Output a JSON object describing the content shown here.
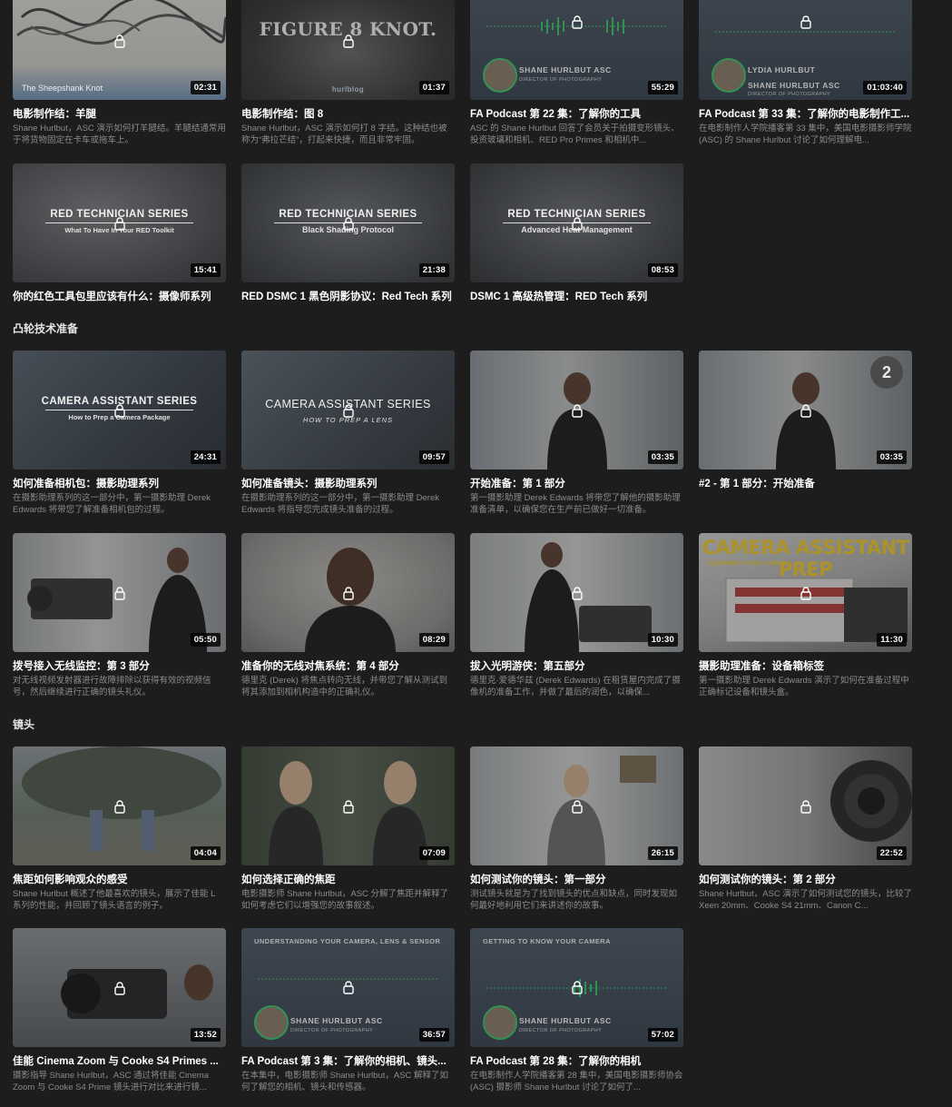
{
  "sections": [
    {
      "title": ""
    },
    {
      "title": "凸轮技术准备"
    },
    {
      "title": "镜头"
    }
  ],
  "rows": [
    [
      {
        "title": "电影制作结：羊腿",
        "desc": "Shane Hurlbut，ASC 演示如何打羊腿结。羊腿结通常用于将货物固定在卡车或拖车上。",
        "duration": "02:31",
        "overlay": "The Sheepshank Knot",
        "thumb_icon": "rope-knot"
      },
      {
        "title": "电影制作结：图 8",
        "desc": "Shane Hurlbut，ASC 演示如何打 8 字结。这种结也被称为“弗拉芒结”，打起来快捷，而且非常牢固。",
        "duration": "01:37",
        "overlay": "FIGURE 8 KNOT.",
        "brand": "hurlblog",
        "thumb_icon": "rope"
      },
      {
        "title": "FA Podcast 第 22 集：了解你的工具",
        "desc": "ASC 的 Shane Hurlbut 回答了会员关于拍摄变形镜头、投资玻璃和相机、RED Pro Primes 和相机中...",
        "duration": "55:29",
        "podcast_name": "SHANE HURLBUT ASC",
        "podcast_role": "DIRECTOR OF PHOTOGRAPHY"
      },
      {
        "title": "FA Podcast 第 33 集：了解你的电影制作工...",
        "desc": "在电影制作人学院播客第 33 集中，美国电影摄影师学院 (ASC) 的 Shane Hurlbut 讨论了如何理解电...",
        "duration": "01:03:40",
        "podcast_name": "LYDIA HURLBUT",
        "podcast_name2": "SHANE HURLBUT ASC",
        "podcast_role": "DIRECTOR OF PHOTOGRAPHY"
      }
    ],
    [
      {
        "title": "你的红色工具包里应该有什么：摄像师系列",
        "desc": "",
        "duration": "15:41",
        "overlay": "RED TECHNICIAN SERIES",
        "overlay_sub": "What To Have In Your RED Toolkit"
      },
      {
        "title": "RED DSMC 1 黑色阴影协议：Red Tech 系列",
        "desc": "",
        "duration": "21:38",
        "overlay": "RED TECHNICIAN SERIES",
        "overlay_sub": "Black Shading Protocol"
      },
      {
        "title": "DSMC 1 高级热管理：RED Tech 系列",
        "desc": "",
        "duration": "08:53",
        "overlay": "RED TECHNICIAN SERIES",
        "overlay_sub": "Advanced Heat Management"
      }
    ],
    [
      {
        "title": "如何准备相机包：摄影助理系列",
        "desc": "在摄影助理系列的这一部分中，第一摄影助理 Derek Edwards 将带您了解准备相机包的过程。",
        "duration": "24:31",
        "overlay": "CAMERA ASSISTANT SERIES",
        "overlay_sub": "How to Prep a Camera Package"
      },
      {
        "title": "如何准备镜头：摄影助理系列",
        "desc": "在摄影助理系列的这一部分中，第一摄影助理 Derek Edwards 将指导您完成镜头准备的过程。",
        "duration": "09:57",
        "overlay": "CAMERA ASSISTANT SERIES",
        "overlay_sub": "HOW TO PREP A LENS"
      },
      {
        "title": "开始准备：第 1 部分",
        "desc": "第一摄影助理 Derek Edwards 将带您了解他的摄影助理准备清单，以确保您在生产前已做好一切准备。",
        "duration": "03:35"
      },
      {
        "title": "#2 - 第 1 部分：开始准备",
        "desc": "",
        "duration": "03:35",
        "badge": "2"
      }
    ],
    [
      {
        "title": "拨号接入无线监控：第 3 部分",
        "desc": "对无线视频发射器进行故障排除以获得有效的视频信号，然后继续进行正确的镜头礼仪。",
        "duration": "05:50"
      },
      {
        "title": "准备你的无线对焦系统：第 4 部分",
        "desc": "德里克 (Derek) 将焦点转向无线，并带您了解从测试到将其添加到相机构造中的正确礼仪。",
        "duration": "08:29"
      },
      {
        "title": "拔入光明游侠：第五部分",
        "desc": "德里克·爱德华兹 (Derek Edwards) 在租赁屋内完成了摄像机的准备工作，并做了最后的润色，以确保...",
        "duration": "10:30"
      },
      {
        "title": "摄影助理准备：设备箱标签",
        "desc": "第一摄影助理 Derek Edwards 演示了如何在准备过程中正确标记设备和镜头盒。",
        "duration": "11:30",
        "overlay": "CAMERA ASSISTANT PREP",
        "overlay_sub": "EQUIPMENT CASE LABELS"
      }
    ],
    [
      {
        "title": "焦距如何影响观众的感受",
        "desc": "Shane Hurlbut 概述了他最喜欢的镜头，展示了佳能 L 系列的性能，并回顾了镜头语言的例子。",
        "duration": "04:04"
      },
      {
        "title": "如何选择正确的焦距",
        "desc": "电影摄影师 Shane Hurlbut，ASC 分解了焦距并解释了如何考虑它们以增强您的故事叙述。",
        "duration": "07:09"
      },
      {
        "title": "如何测试你的镜头：第一部分",
        "desc": "测试镜头就是为了找到镜头的优点和缺点，同时发现如何最好地利用它们来讲述你的故事。",
        "duration": "26:15"
      },
      {
        "title": "如何测试你的镜头：第 2 部分",
        "desc": "Shane Hurlbut，ASC 演示了如何测试您的镜头，比较了 Xeen 20mm、Cooke S4 21mm、Canon C...",
        "duration": "22:52"
      }
    ],
    [
      {
        "title": "佳能 Cinema Zoom 与 Cooke S4 Primes ...",
        "desc": "摄影指导 Shane Hurlbut，ASC 通过将佳能 Cinema Zoom 与 Cooke S4 Prime 镜头进行对比来进行镜...",
        "duration": "13:52"
      },
      {
        "title": "FA Podcast 第 3 集：了解你的相机、镜头...",
        "desc": "在本集中，电影摄影师 Shane Hurlbut，ASC 解释了如何了解您的相机、镜头和传感器。",
        "duration": "36:57",
        "podcast_top": "UNDERSTANDING YOUR CAMERA, LENS & SENSOR",
        "podcast_name": "SHANE HURLBUT ASC",
        "podcast_role": "DIRECTOR OF PHOTOGRAPHY"
      },
      {
        "title": "FA Podcast 第 28 集：了解你的相机",
        "desc": "在电影制作人学院播客第 28 集中，美国电影摄影师协会 (ASC) 摄影师 Shane Hurlbut 讨论了如何了...",
        "duration": "57:02",
        "podcast_top": "GETTING TO KNOW YOUR CAMERA",
        "podcast_name": "SHANE HURLBUT ASC",
        "podcast_role": "DIRECTOR OF PHOTOGRAPHY"
      }
    ]
  ],
  "colors": {
    "background": "#1d1d1d",
    "title": "#ffffff",
    "desc": "#8b8b8b",
    "podcast_green": "#3cc26a",
    "prep_yellow": "#e5c333"
  },
  "icons": {
    "lock": "lock-icon"
  }
}
